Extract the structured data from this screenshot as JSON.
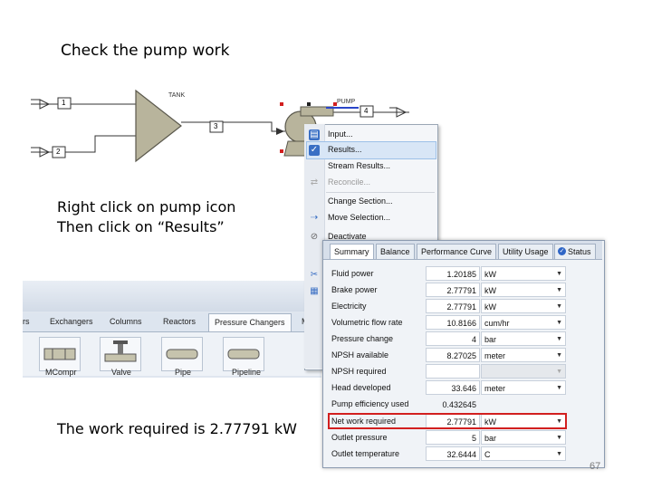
{
  "slide": {
    "title": "Check the pump work",
    "instruction_line1": "Right click on pump icon",
    "instruction_line2": "Then click on “Results”",
    "work_caption": "The work required is 2.77791 kW",
    "page_number": "67"
  },
  "flowsheet": {
    "tank_label": "TANK",
    "pump_label": "PUMP",
    "streams": [
      "1",
      "2",
      "3",
      "4"
    ]
  },
  "ribbon": {
    "tabs": [
      "rs",
      "Exchangers",
      "Columns",
      "Reactors",
      "Pressure Changers",
      "M"
    ],
    "active_tab": "Pressure Changers",
    "tools": [
      "MCompr",
      "Valve",
      "Pipe",
      "Pipeline"
    ]
  },
  "context_menu": {
    "items": [
      {
        "label": "Input...",
        "icon": "input-icon",
        "enabled": true
      },
      {
        "label": "Results...",
        "icon": "results-icon",
        "enabled": true,
        "hovered": true
      },
      {
        "label": "Stream Results...",
        "icon": "",
        "enabled": true
      },
      {
        "label": "Reconcile...",
        "icon": "reconcile-icon",
        "enabled": false
      },
      {
        "label": "Change Section...",
        "icon": "",
        "enabled": true
      },
      {
        "label": "Move Selection...",
        "icon": "move-icon",
        "enabled": true
      },
      {
        "label": "Deactivate",
        "icon": "deactivate-icon",
        "enabled": true
      }
    ]
  },
  "results_panel": {
    "tabs": [
      "Summary",
      "Balance",
      "Performance Curve",
      "Utility Usage",
      "Status"
    ],
    "active_tab": "Summary",
    "rows": [
      {
        "label": "Fluid power",
        "value": "1.20185",
        "unit": "kW"
      },
      {
        "label": "Brake power",
        "value": "2.77791",
        "unit": "kW"
      },
      {
        "label": "Electricity",
        "value": "2.77791",
        "unit": "kW"
      },
      {
        "label": "Volumetric flow rate",
        "value": "10.8166",
        "unit": "cum/hr"
      },
      {
        "label": "Pressure change",
        "value": "4",
        "unit": "bar"
      },
      {
        "label": "NPSH available",
        "value": "8.27025",
        "unit": "meter"
      },
      {
        "label": "NPSH required",
        "value": "",
        "unit": ""
      },
      {
        "label": "Head developed",
        "value": "33.646",
        "unit": "meter"
      },
      {
        "label": "Pump efficiency used",
        "value": "0.432645",
        "unit": ""
      },
      {
        "label": "Net work required",
        "value": "2.77791",
        "unit": "kW"
      },
      {
        "label": "Outlet pressure",
        "value": "5",
        "unit": "bar"
      },
      {
        "label": "Outlet temperature",
        "value": "32.6444",
        "unit": "C"
      }
    ]
  },
  "colors": {
    "highlight": "#d21f1f",
    "unit_body": "#b8b49c",
    "menu_hover": "#d8e6f6"
  }
}
